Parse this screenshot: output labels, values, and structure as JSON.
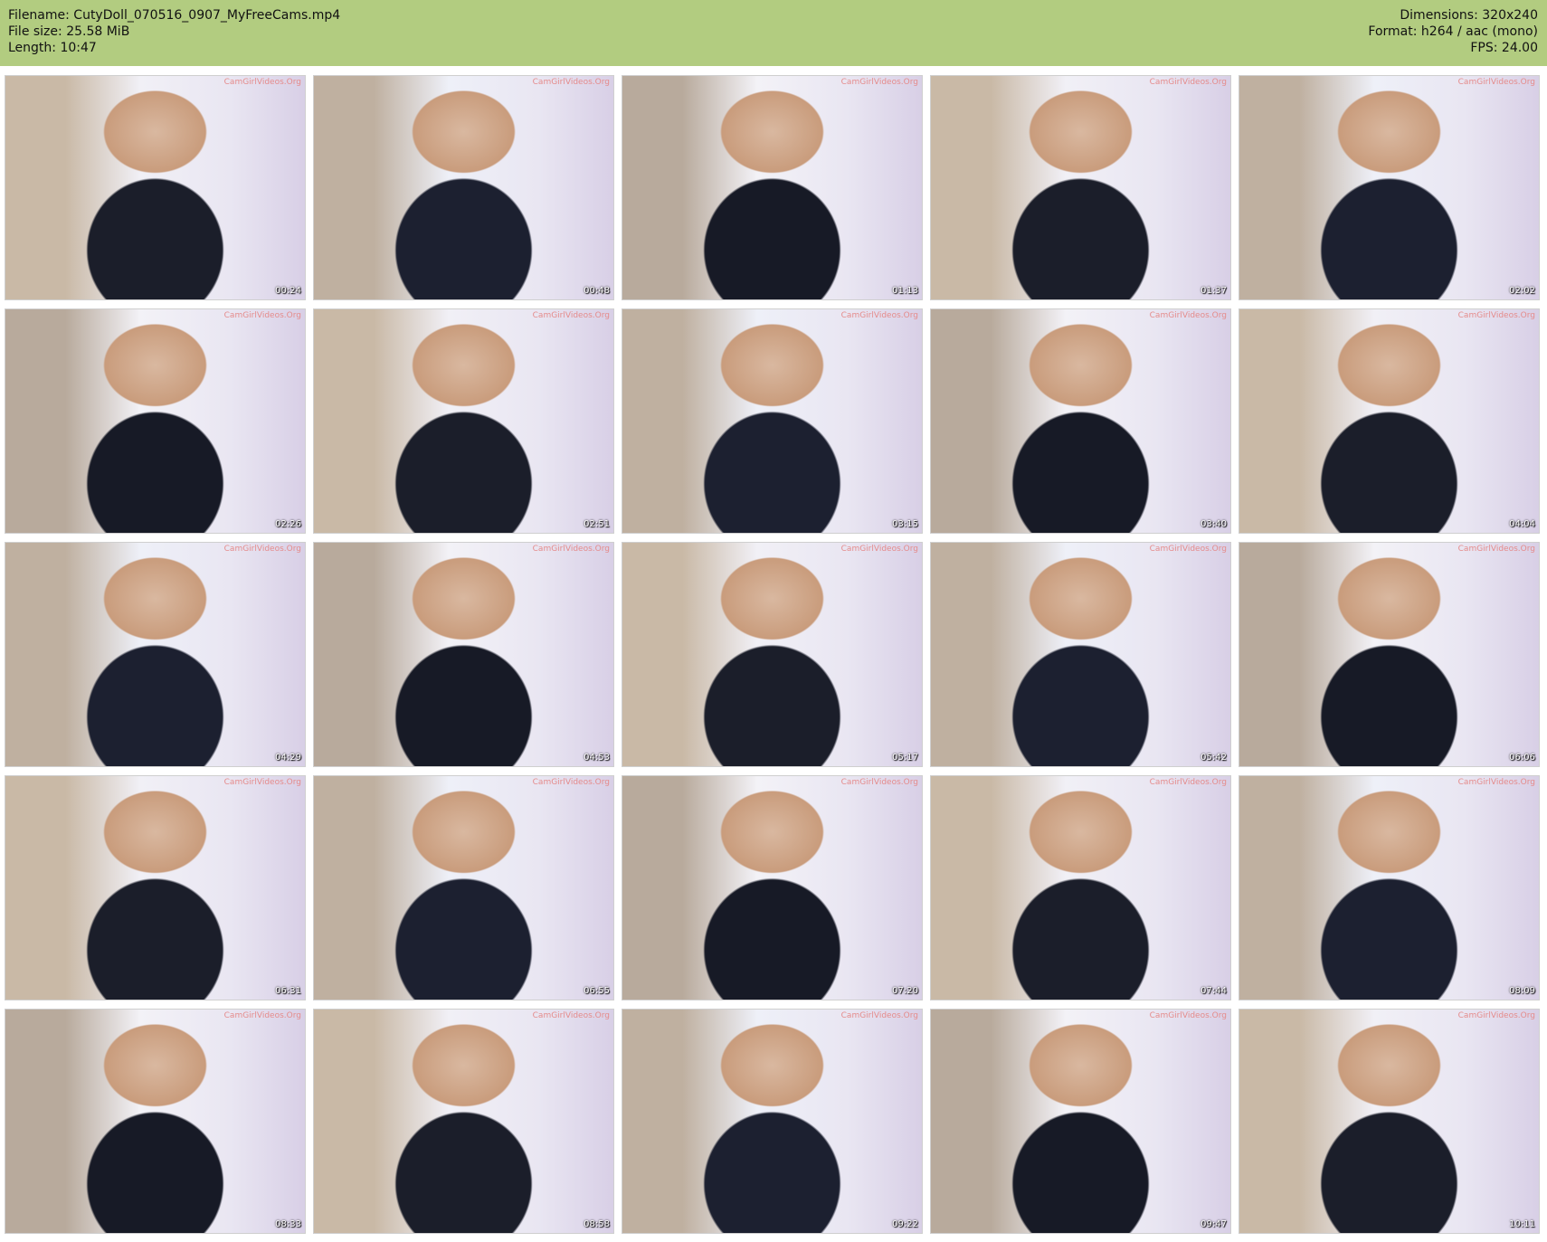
{
  "header": {
    "filename": "Filename: CutyDoll_070516_0907_MyFreeCams.mp4",
    "filesize": "File size: 25.58 MiB",
    "length": "Length: 10:47",
    "dimensions": "Dimensions: 320x240",
    "format": "Format: h264 / aac (mono)",
    "fps": "FPS: 24.00"
  },
  "colors": {
    "header_bg": "#b2cc80"
  },
  "thumbnails": [
    {
      "time": "00:24"
    },
    {
      "time": "00:48"
    },
    {
      "time": "01:13"
    },
    {
      "time": "01:37"
    },
    {
      "time": "02:02"
    },
    {
      "time": "02:26"
    },
    {
      "time": "02:51"
    },
    {
      "time": "03:15"
    },
    {
      "time": "03:40"
    },
    {
      "time": "04:04"
    },
    {
      "time": "04:29"
    },
    {
      "time": "04:53"
    },
    {
      "time": "05:17"
    },
    {
      "time": "05:42"
    },
    {
      "time": "06:06"
    },
    {
      "time": "06:31"
    },
    {
      "time": "06:55"
    },
    {
      "time": "07:20"
    },
    {
      "time": "07:44"
    },
    {
      "time": "08:09"
    },
    {
      "time": "08:33"
    },
    {
      "time": "08:58"
    },
    {
      "time": "09:22"
    },
    {
      "time": "09:47"
    },
    {
      "time": "10:11"
    }
  ]
}
